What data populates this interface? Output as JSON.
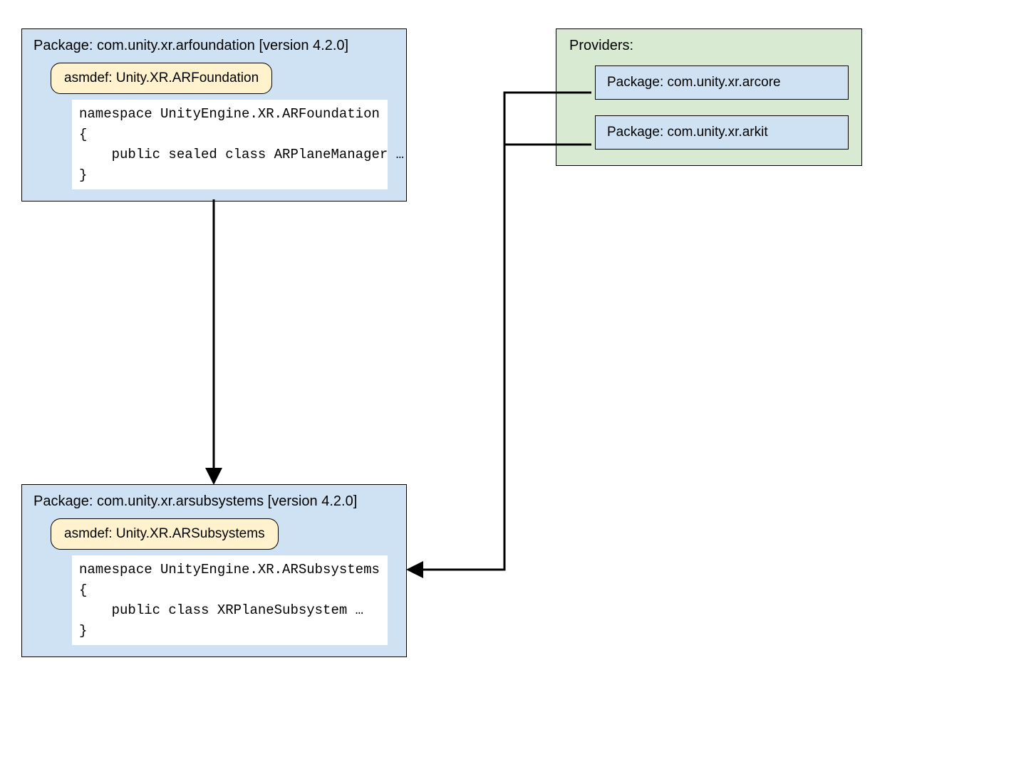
{
  "arfoundation": {
    "title": "Package: com.unity.xr.arfoundation [version 4.2.0]",
    "asmdef": "asmdef: Unity.XR.ARFoundation",
    "code": "namespace UnityEngine.XR.ARFoundation\n{\n    public sealed class ARPlaneManager …\n}"
  },
  "arsubsystems": {
    "title": "Package: com.unity.xr.arsubsystems [version 4.2.0]",
    "asmdef": "asmdef: Unity.XR.ARSubsystems",
    "code": "namespace UnityEngine.XR.ARSubsystems\n{\n    public class XRPlaneSubsystem …\n}"
  },
  "providers": {
    "title": "Providers:",
    "items": [
      "Package: com.unity.xr.arcore",
      "Package: com.unity.xr.arkit"
    ]
  }
}
